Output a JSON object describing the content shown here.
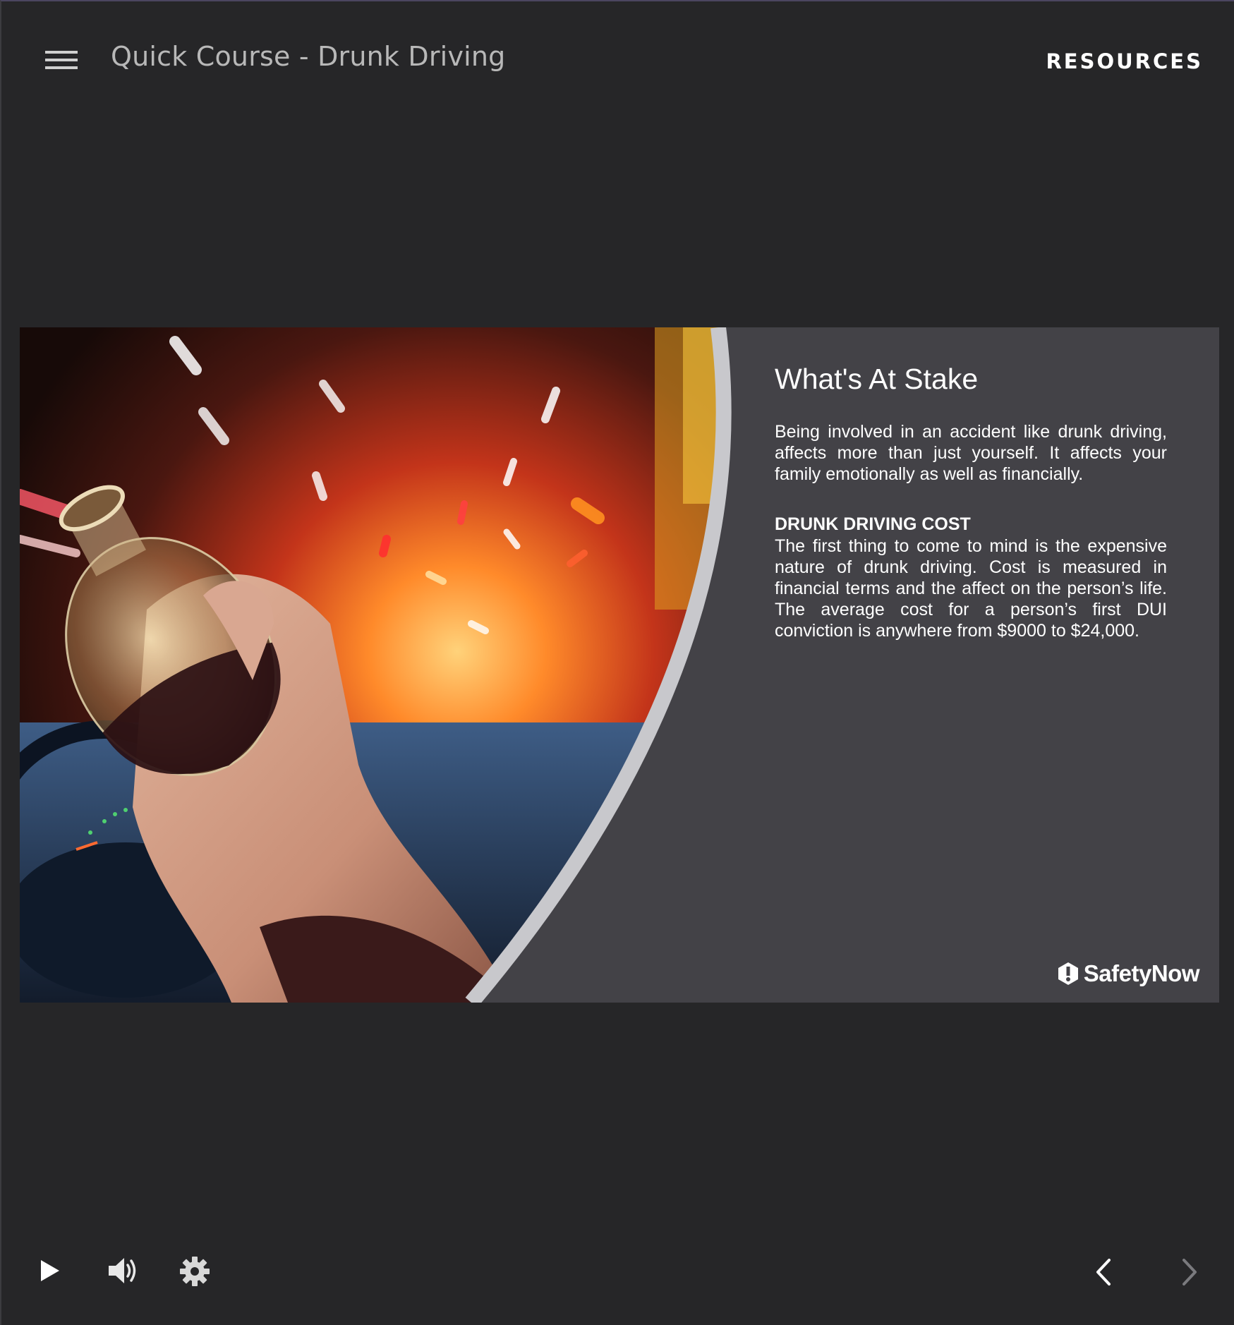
{
  "header": {
    "course_title": "Quick Course - Drunk Driving",
    "resources_label": "RESOURCES",
    "menu_icon": "hamburger-menu-icon"
  },
  "slide": {
    "image_icon": "drunk-driver-photo",
    "heading": "What's At Stake",
    "intro": "Being involved in an accident like drunk driving, affects more than just yourself. It affects your family emotionally as well as financially.",
    "subheading": "DRUNK DRIVING COST",
    "body": "The first thing to come to mind is the expensive nature of drunk driving. Cost is measured in financial terms and the affect on the person’s life. The average cost for a person’s first DUI conviction is anywhere from $9000 to $24,000.",
    "logo_text": "SafetyNow"
  },
  "controls": {
    "play_icon": "play-icon",
    "volume_icon": "volume-icon",
    "settings_icon": "gear-icon",
    "prev_icon": "chevron-left-icon",
    "next_icon": "chevron-right-icon"
  },
  "colors": {
    "background": "#262628",
    "slide_panel": "#434247",
    "arc": "#c8c8cc",
    "text": "#ffffff",
    "title_text": "#b8b8b8"
  }
}
